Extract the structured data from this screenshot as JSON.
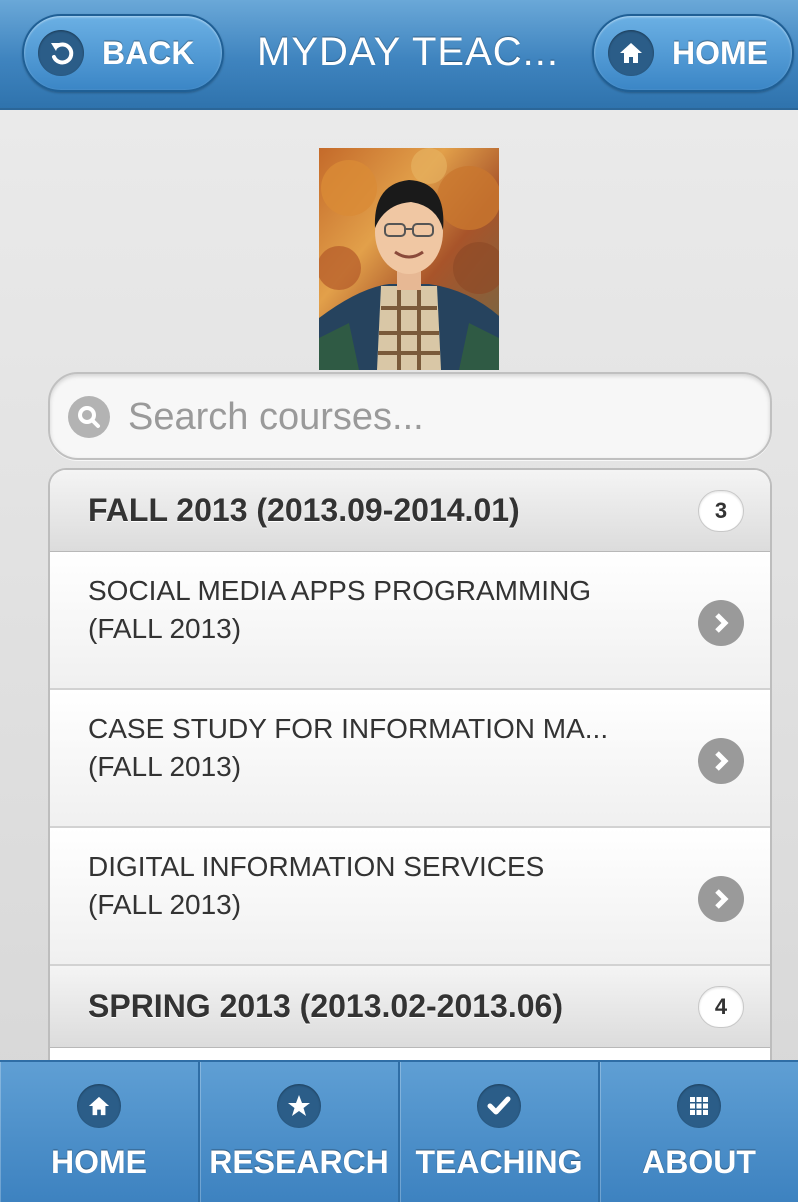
{
  "header": {
    "back_label": "BACK",
    "title": "MYDAY TEAC...",
    "home_label": "HOME"
  },
  "search": {
    "placeholder": "Search courses..."
  },
  "sections": [
    {
      "label": "FALL 2013 (2013.09-2014.01)",
      "count": "3",
      "items": [
        {
          "line1": "SOCIAL MEDIA APPS PROGRAMMING",
          "line2": "(FALL 2013)"
        },
        {
          "line1": "CASE STUDY FOR INFORMATION MA...",
          "line2": "(FALL 2013)"
        },
        {
          "line1": "DIGITAL INFORMATION SERVICES",
          "line2": "(FALL 2013)"
        }
      ]
    },
    {
      "label": "SPRING 2013 (2013.02-2013.06)",
      "count": "4"
    }
  ],
  "nav": {
    "tabs": [
      {
        "label": "HOME",
        "icon": "home-icon"
      },
      {
        "label": "RESEARCH",
        "icon": "star-icon"
      },
      {
        "label": "TEACHING",
        "icon": "check-icon"
      },
      {
        "label": "ABOUT",
        "icon": "grid-icon"
      }
    ]
  },
  "colors": {
    "header_blue": "#3f84bf",
    "icon_dark_blue": "#2b5d88",
    "chevron_gray": "#9a9a9a"
  }
}
